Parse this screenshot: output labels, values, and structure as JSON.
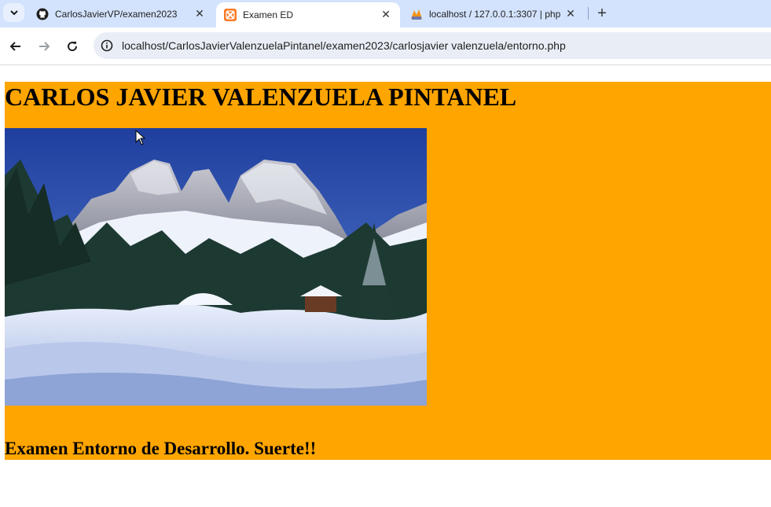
{
  "browser": {
    "tabs": [
      {
        "title": "CarlosJavierVP/examen2023",
        "favicon": "github-icon",
        "active": false
      },
      {
        "title": "Examen ED",
        "favicon": "xampp-icon",
        "active": true
      },
      {
        "title": "localhost / 127.0.0.1:3307 | php",
        "favicon": "phpmyadmin-icon",
        "active": false
      }
    ],
    "address_bar": {
      "url": "localhost/CarlosJavierValenzuelaPintanel/examen2023/carlosjavier valenzuela/entorno.php"
    },
    "icons": [
      "tab-search-icon",
      "close-icon",
      "new-tab-icon",
      "back-icon",
      "forward-icon",
      "reload-icon",
      "info-icon"
    ]
  },
  "page": {
    "background_color": "#ffa500",
    "heading": "CARLOS JAVIER VALENZUELA PINTANEL",
    "image_subject": "snowy mountain landscape with pine trees",
    "subheading": "Examen Entorno de Desarrollo. Suerte!!"
  }
}
